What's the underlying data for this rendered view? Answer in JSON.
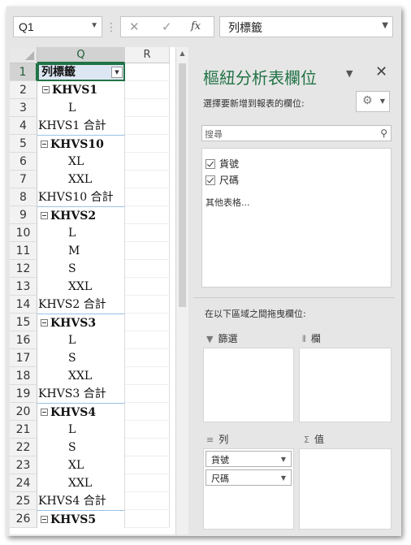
{
  "formula_bar": {
    "name_box": "Q1",
    "sep": "⋮",
    "cancel": "✕",
    "enter": "✓",
    "fx": "fx",
    "formula": "列標籤"
  },
  "sheet": {
    "columns": [
      "Q",
      "R"
    ],
    "rows": [
      {
        "n": "1",
        "text": "列標籤",
        "kind": "first"
      },
      {
        "n": "2",
        "text": "KHVS1",
        "kind": "group"
      },
      {
        "n": "3",
        "text": "L",
        "kind": "item"
      },
      {
        "n": "4",
        "text": "KHVS1 合計",
        "kind": "total"
      },
      {
        "n": "5",
        "text": "KHVS10",
        "kind": "group"
      },
      {
        "n": "6",
        "text": "XL",
        "kind": "item"
      },
      {
        "n": "7",
        "text": "XXL",
        "kind": "item"
      },
      {
        "n": "8",
        "text": "KHVS10 合計",
        "kind": "total"
      },
      {
        "n": "9",
        "text": "KHVS2",
        "kind": "group"
      },
      {
        "n": "10",
        "text": "L",
        "kind": "item"
      },
      {
        "n": "11",
        "text": "M",
        "kind": "item"
      },
      {
        "n": "12",
        "text": "S",
        "kind": "item"
      },
      {
        "n": "13",
        "text": "XXL",
        "kind": "item"
      },
      {
        "n": "14",
        "text": "KHVS2 合計",
        "kind": "total"
      },
      {
        "n": "15",
        "text": "KHVS3",
        "kind": "group"
      },
      {
        "n": "16",
        "text": "L",
        "kind": "item"
      },
      {
        "n": "17",
        "text": "S",
        "kind": "item"
      },
      {
        "n": "18",
        "text": "XXL",
        "kind": "item"
      },
      {
        "n": "19",
        "text": "KHVS3 合計",
        "kind": "total"
      },
      {
        "n": "20",
        "text": "KHVS4",
        "kind": "group"
      },
      {
        "n": "21",
        "text": "L",
        "kind": "item"
      },
      {
        "n": "22",
        "text": "S",
        "kind": "item"
      },
      {
        "n": "23",
        "text": "XL",
        "kind": "item"
      },
      {
        "n": "24",
        "text": "XXL",
        "kind": "item"
      },
      {
        "n": "25",
        "text": "KHVS4 合計",
        "kind": "total"
      },
      {
        "n": "26",
        "text": "KHVS5",
        "kind": "group"
      }
    ]
  },
  "pane": {
    "title": "樞紐分析表欄位",
    "subtitle": "選擇要新增到報表的欄位:",
    "search_placeholder": "搜尋",
    "fields": [
      {
        "label": "貨號",
        "checked": true
      },
      {
        "label": "尺碼",
        "checked": true
      }
    ],
    "more_tables": "其他表格...",
    "drag_label": "在以下區域之間拖曳欄位:",
    "areas": {
      "filters": "篩選",
      "columns": "欄",
      "rows": "列",
      "values": "值"
    },
    "row_fields": [
      "貨號",
      "尺碼"
    ]
  }
}
